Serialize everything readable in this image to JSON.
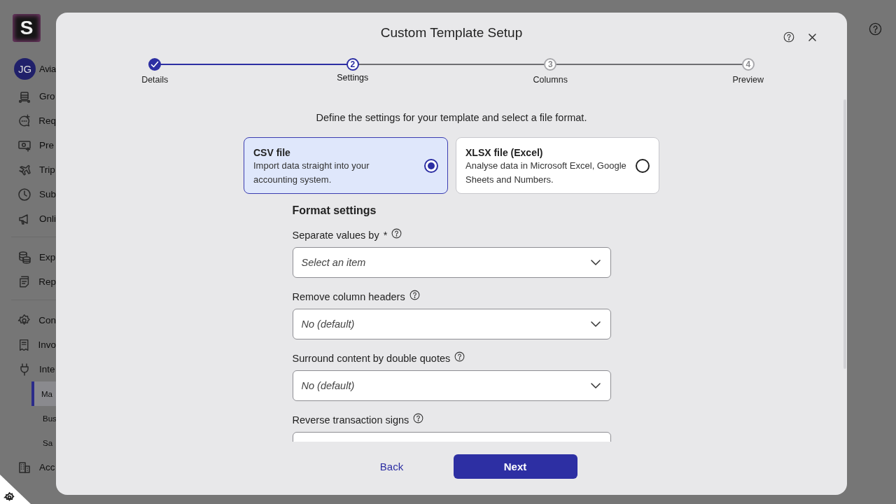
{
  "app": {
    "logo_letter": "S",
    "user": {
      "initials": "JG",
      "name": "Avia"
    },
    "nav_groups": [
      {
        "items": [
          {
            "kind": "item",
            "label": "Gro",
            "selected": false
          },
          {
            "kind": "item",
            "label": "Req",
            "selected": false
          },
          {
            "kind": "item",
            "label": "Pre",
            "selected": false
          },
          {
            "kind": "item",
            "label": "Trip",
            "selected": false
          },
          {
            "kind": "item",
            "label": "Sub",
            "selected": false
          },
          {
            "kind": "item",
            "label": "Onli",
            "selected": false
          }
        ]
      },
      {
        "items": [
          {
            "kind": "item",
            "label": "Exp",
            "selected": false
          },
          {
            "kind": "item",
            "label": "Rep",
            "selected": false
          }
        ]
      },
      {
        "items": [
          {
            "kind": "item",
            "label": "Con",
            "selected": false
          },
          {
            "kind": "item",
            "label": "Invo",
            "selected": false
          },
          {
            "kind": "item",
            "label": "Inte",
            "selected": false
          },
          {
            "kind": "sub",
            "label": "Ma",
            "selected": true
          },
          {
            "kind": "sub",
            "label": "Bus",
            "selected": false
          },
          {
            "kind": "sub",
            "label": "Sa",
            "selected": false
          },
          {
            "kind": "item",
            "label": "Acc",
            "selected": false
          }
        ]
      }
    ]
  },
  "modal": {
    "title": "Custom Template Setup",
    "steps": [
      {
        "label": "Details",
        "completed": true,
        "selected": false
      },
      {
        "number": "2",
        "label": "Settings",
        "completed": false,
        "selected": true
      },
      {
        "number": "3",
        "label": "Columns",
        "completed": false,
        "selected": false
      },
      {
        "number": "4",
        "label": "Preview",
        "completed": false,
        "selected": false
      }
    ],
    "intro": "Define the settings for your template and select a file format.",
    "formats": [
      {
        "title": "CSV file",
        "description": "Import data straight into your accounting system.",
        "selected": true
      },
      {
        "title": "XLSX file (Excel)",
        "description": "Analyse data in Microsoft Excel, Google Sheets and Numbers.",
        "selected": false
      }
    ],
    "section_title": "Format settings",
    "fields": [
      {
        "label": "Separate values by",
        "required_mark": "*",
        "placeholder": "Select an item"
      },
      {
        "label": "Remove column headers",
        "value": "No (default)"
      },
      {
        "label": "Surround content by double quotes",
        "value": "No (default)"
      },
      {
        "label": "Reverse transaction signs"
      }
    ],
    "back_button": "Back",
    "next_button": "Next"
  }
}
